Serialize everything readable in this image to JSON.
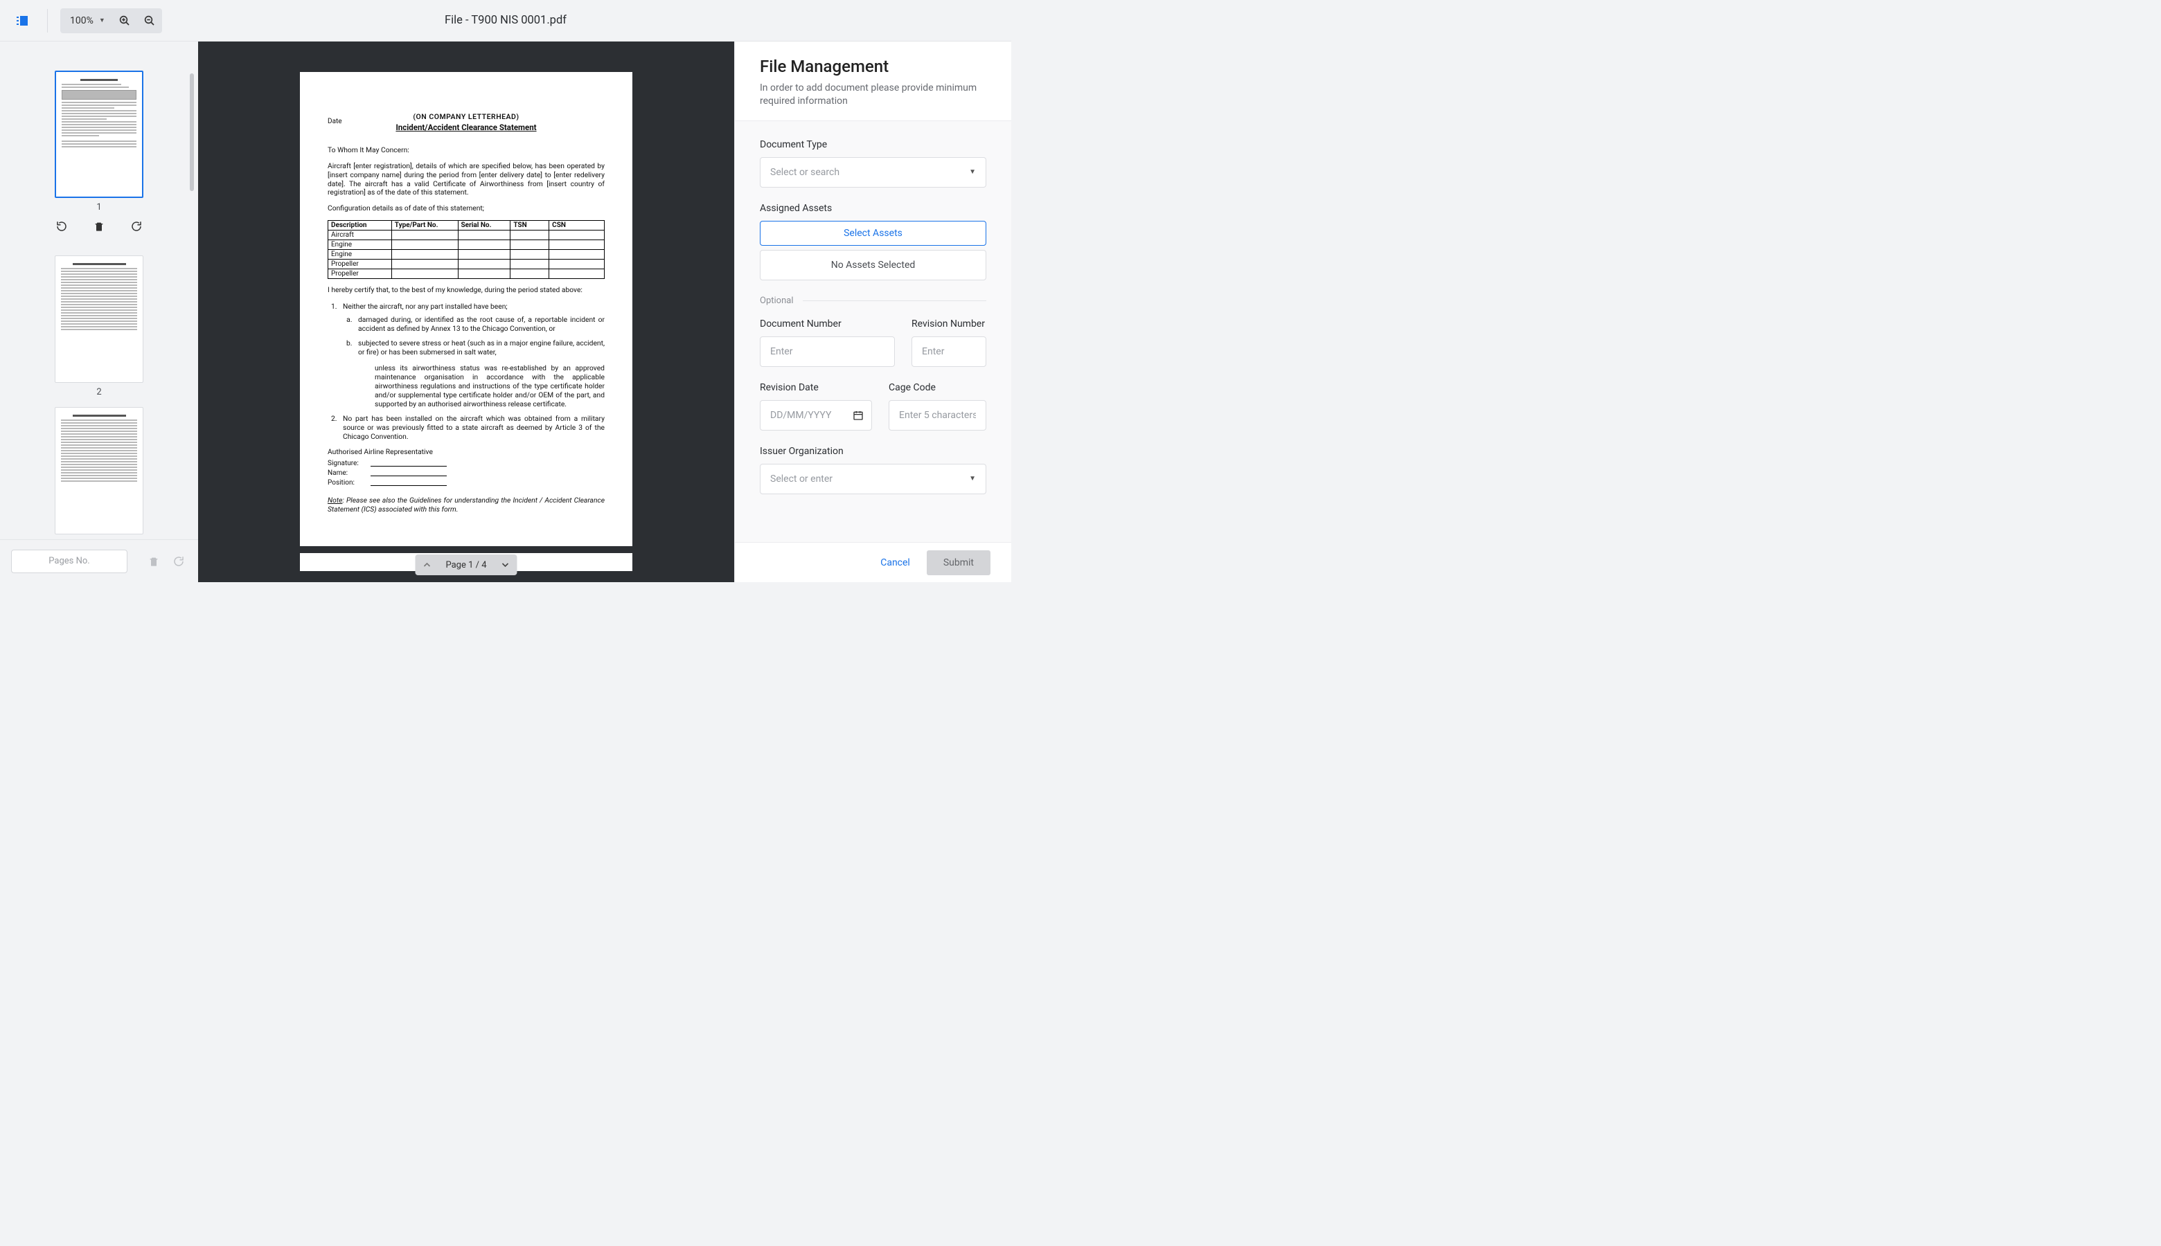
{
  "toolbar": {
    "zoom_label": "100%",
    "title_prefix": "File - ",
    "title_filename": "T900 NIS 0001.pdf"
  },
  "thumbnails": {
    "pages": [
      "1",
      "2"
    ],
    "footer_placeholder": "Pages No."
  },
  "page_nav": {
    "label": "Page 1 / 4"
  },
  "document": {
    "letterhead": "(ON COMPANY LETTERHEAD)",
    "date_label": "Date",
    "title": "Incident/Accident Clearance Statement",
    "salutation": "To Whom It May Concern:",
    "para1": "Aircraft [enter registration], details of which are specified below, has been operated by [insert company name] during the period from [enter delivery date] to [enter redelivery date]. The aircraft has a valid Certificate of Airworthiness from [insert country of registration] as of the date of this statement.",
    "config_intro": "Configuration details as of date of this statement;",
    "table": {
      "headers": [
        "Description",
        "Type/Part No.",
        "Serial No.",
        "TSN",
        "CSN"
      ],
      "rows": [
        "Aircraft",
        "Engine",
        "Engine",
        "Propeller",
        "Propeller"
      ]
    },
    "certify": "I hereby certify that, to the best of my knowledge, during the period stated above:",
    "item1_intro": "Neither the aircraft, nor any part installed have been;",
    "item1_a": "damaged during, or identified as the root cause of, a reportable incident or accident as defined by Annex 13 to the Chicago Convention, or",
    "item1_b": "subjected to severe stress or heat (such as in a major engine failure, accident, or fire) or has been submersed in salt water,",
    "item1_unless": "unless its airworthiness status was re-established by an approved maintenance organisation in accordance with the applicable airworthiness regulations and instructions of the type certificate holder and/or supplemental type certificate holder and/or OEM of the part, and supported by an authorised airworthiness release certificate.",
    "item2": "No part has been installed on the aircraft which was obtained from a military source or was previously fitted to a state aircraft as deemed by Article 3 of the Chicago Convention.",
    "rep_heading": "Authorised Airline Representative",
    "sig_label": "Signature:",
    "name_label": "Name:",
    "position_label": "Position:",
    "note_label": "Note",
    "note_text": ": Please see also the Guidelines for understanding the Incident / Accident Clearance Statement (ICS) associated with this form."
  },
  "panel": {
    "title": "File Management",
    "subtitle": "In order to add document please provide minimum required information",
    "doc_type_label": "Document Type",
    "doc_type_placeholder": "Select or search",
    "assets_label": "Assigned Assets",
    "assets_button": "Select Assets",
    "assets_empty": "No Assets Selected",
    "optional_label": "Optional",
    "doc_num_label": "Document Number",
    "doc_num_placeholder": "Enter",
    "rev_num_label": "Revision Number",
    "rev_num_placeholder": "Enter",
    "rev_date_label": "Revision Date",
    "rev_date_placeholder": "DD/MM/YYYY",
    "cage_label": "Cage Code",
    "cage_placeholder": "Enter 5 characters",
    "issuer_label": "Issuer Organization",
    "issuer_placeholder": "Select or enter",
    "cancel": "Cancel",
    "submit": "Submit"
  }
}
